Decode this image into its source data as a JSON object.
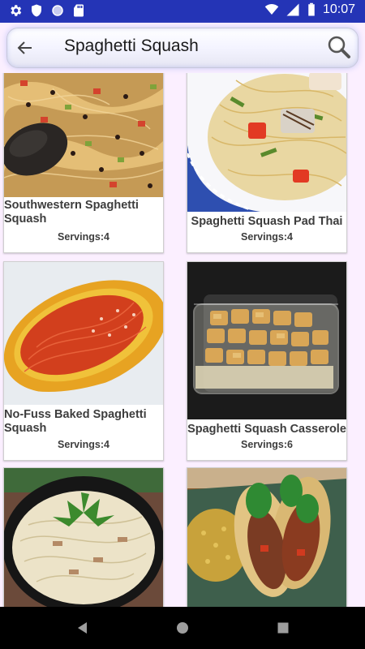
{
  "status_bar": {
    "time": "10:07",
    "left_icons": [
      "gear-icon",
      "shield-icon",
      "circle-icon",
      "sd-card-icon"
    ],
    "right_icons": [
      "wifi-icon",
      "signal-icon",
      "battery-icon"
    ]
  },
  "search": {
    "query": "Spaghetti Squash"
  },
  "recipes": [
    {
      "title": "Southwestern Spaghetti Squash",
      "servings": "Servings:4"
    },
    {
      "title": "Spaghetti Squash Pad Thai",
      "servings": "Servings:4"
    },
    {
      "title": "No-Fuss Baked Spaghetti Squash",
      "servings": "Servings:4"
    },
    {
      "title": "Spaghetti Squash Casserole",
      "servings": "Servings:6"
    },
    {
      "title": "",
      "servings": ""
    },
    {
      "title": "",
      "servings": ""
    }
  ],
  "nav": {
    "buttons": [
      "back-triangle-icon",
      "home-circle-icon",
      "recents-square-icon"
    ]
  }
}
